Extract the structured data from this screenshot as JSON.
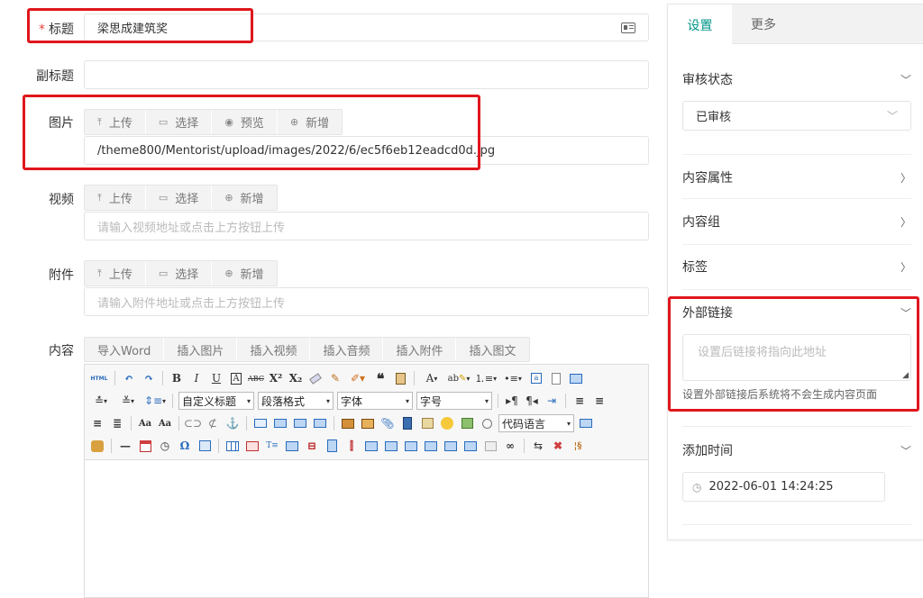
{
  "form": {
    "title_label": "标题",
    "required_mark": "*",
    "title_value": "梁思成建筑奖",
    "subtitle_label": "副标题",
    "subtitle_value": "",
    "image_label": "图片",
    "image_buttons": [
      "上传",
      "选择",
      "预览",
      "新增"
    ],
    "image_value": "/theme800/Mentorist/upload/images/2022/6/ec5f6eb12eadcd0d.jpg",
    "video_label": "视频",
    "video_buttons": [
      "上传",
      "选择",
      "新增"
    ],
    "video_placeholder": "请输入视频地址或点击上方按钮上传",
    "attachment_label": "附件",
    "attachment_buttons": [
      "上传",
      "选择",
      "新增"
    ],
    "attachment_placeholder": "请输入附件地址或点击上方按钮上传",
    "content_label": "内容",
    "content_buttons": [
      "导入Word",
      "插入图片",
      "插入视频",
      "插入音频",
      "插入附件",
      "插入图文"
    ]
  },
  "editor": {
    "html_label": "HTML",
    "custom_heading": "自定义标题",
    "paragraph_format": "段落格式",
    "font_family": "字体",
    "font_size": "字号",
    "code_language": "代码语言"
  },
  "panel": {
    "tabs": [
      "设置",
      "更多"
    ],
    "review_status_label": "审核状态",
    "review_status_value": "已审核",
    "content_attr_label": "内容属性",
    "content_group_label": "内容组",
    "tags_label": "标签",
    "external_link_label": "外部链接",
    "external_link_placeholder": "设置后链接将指向此地址",
    "external_link_hint": "设置外部链接后系统将不会生成内容页面",
    "add_time_label": "添加时间",
    "add_time_value": "2022-06-01 14:24:25"
  },
  "colors": {
    "accent": "#009688",
    "highlight_border": "#e0161d",
    "required": "#e64340"
  }
}
